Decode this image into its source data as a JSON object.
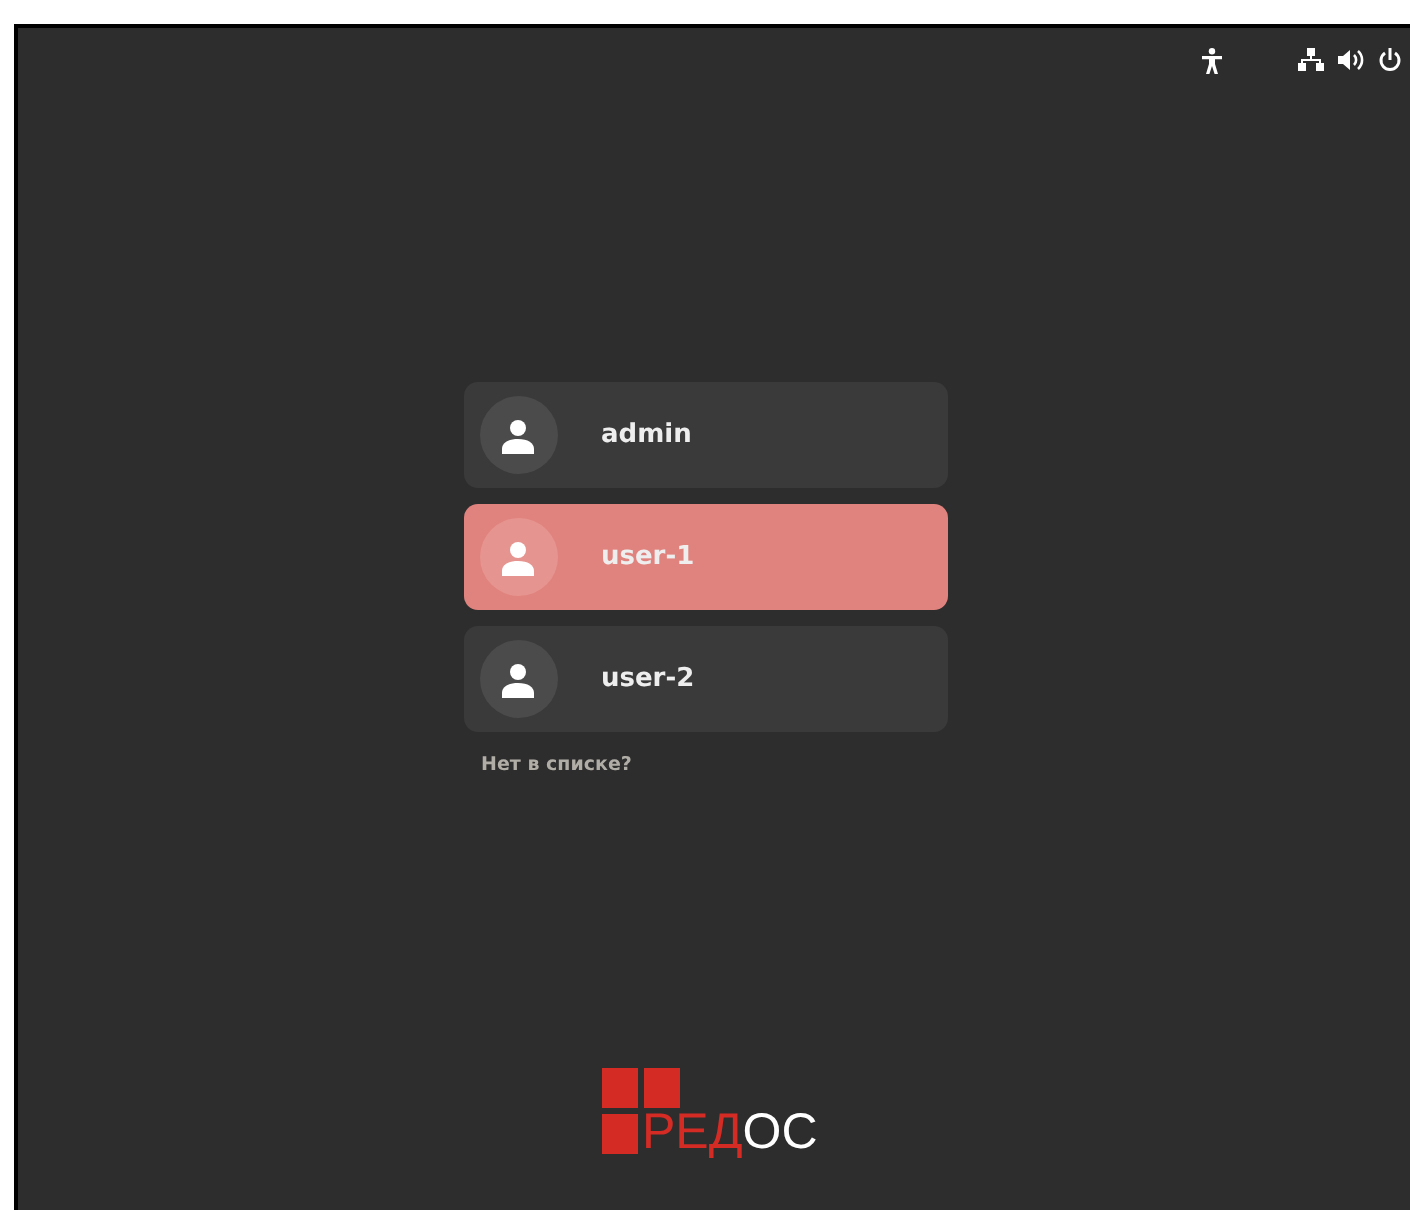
{
  "users": [
    {
      "name": "admin",
      "selected": false
    },
    {
      "name": "user-1",
      "selected": true
    },
    {
      "name": "user-2",
      "selected": false
    }
  ],
  "not_listed_link": "Нет в списке?",
  "logo": {
    "parts": [
      {
        "text": "РЕД",
        "color": "#d52b25"
      },
      {
        "text": "ОС",
        "color": "#ffffff"
      }
    ]
  }
}
